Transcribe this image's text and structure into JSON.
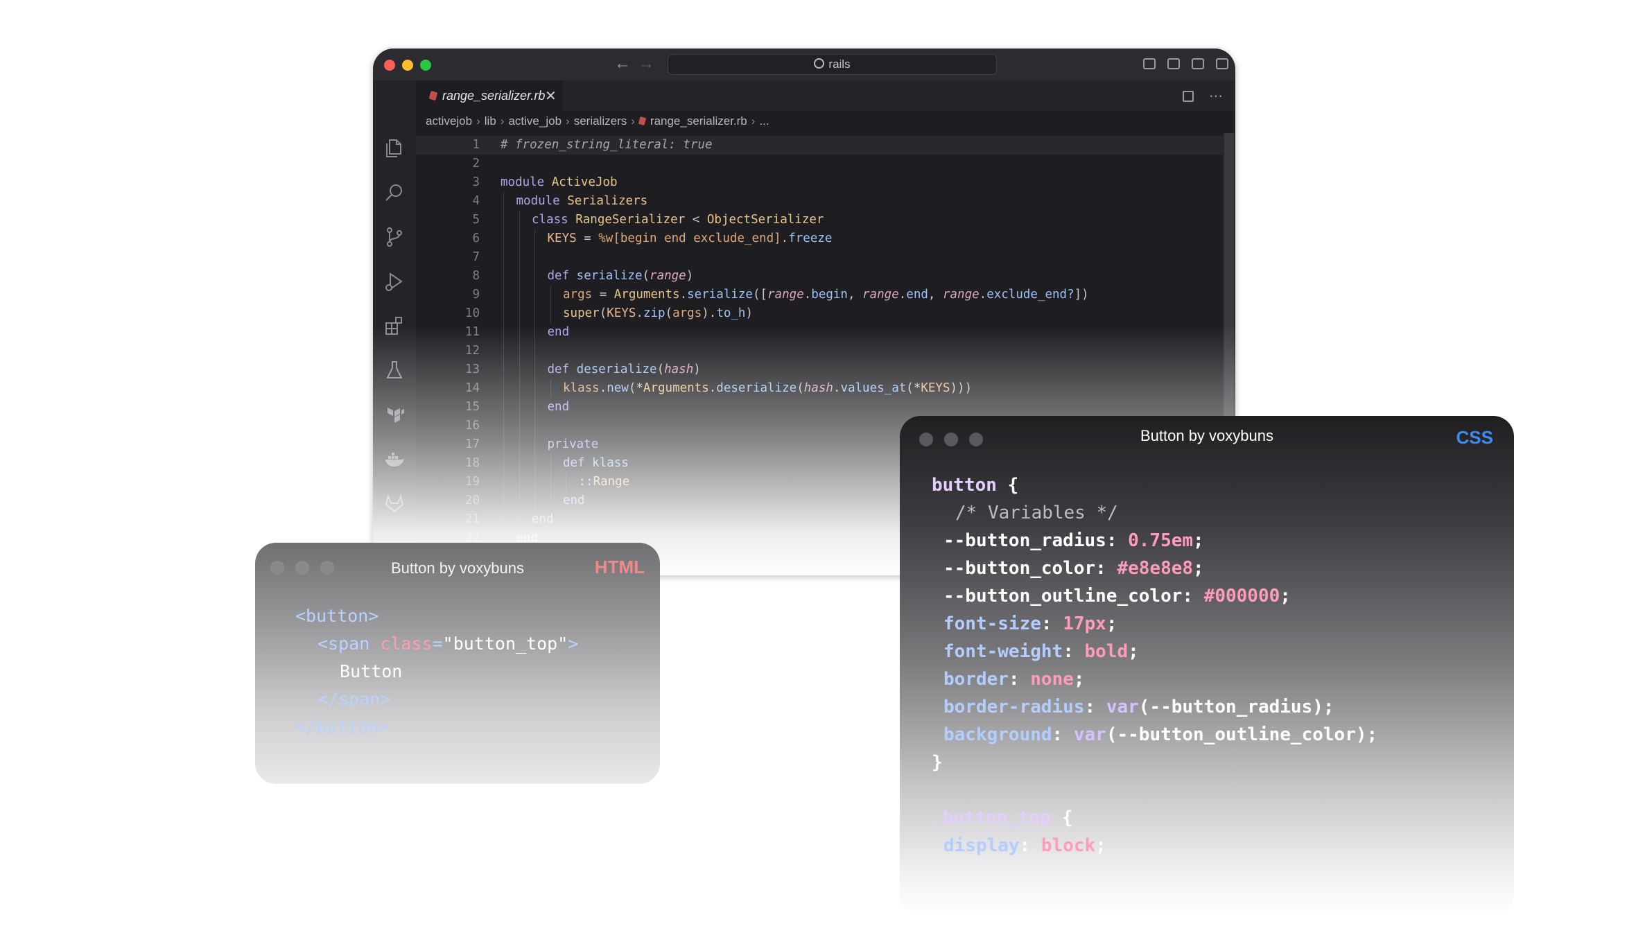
{
  "editor": {
    "search_text": "rails",
    "tab_name": "range_serializer.rb",
    "tab_close": "✕",
    "breadcrumbs": [
      "activejob",
      "lib",
      "active_job",
      "serializers",
      "range_serializer.rb",
      "..."
    ],
    "code_lines": [
      {
        "n": "1",
        "indent": 0,
        "tokens": [
          [
            "cm",
            "# frozen_string_literal: true"
          ]
        ]
      },
      {
        "n": "2",
        "indent": 0,
        "tokens": []
      },
      {
        "n": "3",
        "indent": 0,
        "tokens": [
          [
            "kw",
            "module "
          ],
          [
            "cls",
            "ActiveJob"
          ]
        ]
      },
      {
        "n": "4",
        "indent": 1,
        "tokens": [
          [
            "kw",
            "module "
          ],
          [
            "cls",
            "Serializers"
          ]
        ]
      },
      {
        "n": "5",
        "indent": 2,
        "tokens": [
          [
            "kw",
            "class "
          ],
          [
            "cls",
            "RangeSerializer"
          ],
          [
            "op",
            " < "
          ],
          [
            "cls",
            "ObjectSerializer"
          ]
        ]
      },
      {
        "n": "6",
        "indent": 3,
        "tokens": [
          [
            "const",
            "KEYS"
          ],
          [
            "op",
            " = "
          ],
          [
            "sym",
            "%w[begin end exclude_end]"
          ],
          [
            "op",
            "."
          ],
          [
            "fn",
            "freeze"
          ]
        ]
      },
      {
        "n": "7",
        "indent": 3,
        "tokens": []
      },
      {
        "n": "8",
        "indent": 3,
        "tokens": [
          [
            "kw",
            "def "
          ],
          [
            "fn",
            "serialize"
          ],
          [
            "op",
            "("
          ],
          [
            "it",
            "range"
          ],
          [
            "op",
            ")"
          ]
        ]
      },
      {
        "n": "9",
        "indent": 4,
        "tokens": [
          [
            "sym",
            "args"
          ],
          [
            "op",
            " = "
          ],
          [
            "cls",
            "Arguments"
          ],
          [
            "op",
            "."
          ],
          [
            "fn",
            "serialize"
          ],
          [
            "op",
            "(["
          ],
          [
            "it",
            "range"
          ],
          [
            "op",
            "."
          ],
          [
            "fn",
            "begin"
          ],
          [
            "op",
            ", "
          ],
          [
            "it",
            "range"
          ],
          [
            "op",
            "."
          ],
          [
            "fn",
            "end"
          ],
          [
            "op",
            ", "
          ],
          [
            "it",
            "range"
          ],
          [
            "op",
            "."
          ],
          [
            "fn",
            "exclude_end?"
          ],
          [
            "op",
            "])"
          ]
        ]
      },
      {
        "n": "10",
        "indent": 4,
        "tokens": [
          [
            "cls",
            "super"
          ],
          [
            "op",
            "("
          ],
          [
            "const",
            "KEYS"
          ],
          [
            "op",
            "."
          ],
          [
            "fn",
            "zip"
          ],
          [
            "op",
            "("
          ],
          [
            "sym",
            "args"
          ],
          [
            "op",
            ")."
          ],
          [
            "fn",
            "to_h"
          ],
          [
            "op",
            ")"
          ]
        ]
      },
      {
        "n": "11",
        "indent": 3,
        "tokens": [
          [
            "kw",
            "end"
          ]
        ]
      },
      {
        "n": "12",
        "indent": 3,
        "tokens": []
      },
      {
        "n": "13",
        "indent": 3,
        "tokens": [
          [
            "kw",
            "def "
          ],
          [
            "fn",
            "deserialize"
          ],
          [
            "op",
            "("
          ],
          [
            "it",
            "hash"
          ],
          [
            "op",
            ")"
          ]
        ]
      },
      {
        "n": "14",
        "indent": 4,
        "tokens": [
          [
            "sym",
            "klass"
          ],
          [
            "op",
            "."
          ],
          [
            "fn",
            "new"
          ],
          [
            "op",
            "(*"
          ],
          [
            "cls",
            "Arguments"
          ],
          [
            "op",
            "."
          ],
          [
            "fn",
            "deserialize"
          ],
          [
            "op",
            "("
          ],
          [
            "it",
            "hash"
          ],
          [
            "op",
            "."
          ],
          [
            "fn",
            "values_at"
          ],
          [
            "op",
            "(*"
          ],
          [
            "const",
            "KEYS"
          ],
          [
            "op",
            ")))"
          ]
        ]
      },
      {
        "n": "15",
        "indent": 3,
        "tokens": [
          [
            "kw",
            "end"
          ]
        ]
      },
      {
        "n": "16",
        "indent": 3,
        "tokens": []
      },
      {
        "n": "17",
        "indent": 3,
        "tokens": [
          [
            "kw",
            "private"
          ]
        ]
      },
      {
        "n": "18",
        "indent": 4,
        "tokens": [
          [
            "kw",
            "def "
          ],
          [
            "fn",
            "klass"
          ]
        ]
      },
      {
        "n": "19",
        "indent": 5,
        "tokens": [
          [
            "op",
            "::"
          ],
          [
            "cls",
            "Range"
          ]
        ]
      },
      {
        "n": "20",
        "indent": 4,
        "tokens": [
          [
            "kw",
            "end"
          ]
        ]
      },
      {
        "n": "21",
        "indent": 2,
        "tokens": [
          [
            "kw",
            "end"
          ]
        ]
      },
      {
        "n": "22",
        "indent": 1,
        "tokens": [
          [
            "kw",
            "end"
          ]
        ]
      }
    ]
  },
  "html_window": {
    "title": "Button by voxybuns",
    "lang": "HTML",
    "lines": [
      {
        "indent": 0,
        "tokens": [
          [
            "tag",
            "<button>"
          ]
        ]
      },
      {
        "indent": 1,
        "tokens": [
          [
            "tag",
            "<span "
          ],
          [
            "attr",
            "class"
          ],
          [
            "tag",
            "="
          ],
          [
            "str",
            "\"button_top\""
          ],
          [
            "tag",
            ">"
          ]
        ]
      },
      {
        "indent": 2,
        "tokens": [
          [
            "htxt",
            "Button"
          ]
        ]
      },
      {
        "indent": 1,
        "tokens": [
          [
            "tag",
            "</span>"
          ]
        ]
      },
      {
        "indent": 0,
        "tokens": [
          [
            "tag",
            "</button>"
          ]
        ]
      }
    ]
  },
  "css_window": {
    "title": "Button by voxybuns",
    "lang": "CSS",
    "lines": [
      {
        "indent": 0,
        "tokens": [
          [
            "sel",
            "button "
          ],
          [
            "brace",
            "{"
          ]
        ]
      },
      {
        "indent": 1,
        "tokens": [
          [
            "ccm",
            "/* Variables */"
          ]
        ]
      },
      {
        "indent": 0.5,
        "tokens": [
          [
            "var",
            "--button_radius"
          ],
          [
            "punc",
            ": "
          ],
          [
            "val",
            "0.75em"
          ],
          [
            "punc",
            ";"
          ]
        ]
      },
      {
        "indent": 0.5,
        "tokens": [
          [
            "var",
            "--button_color"
          ],
          [
            "punc",
            ": "
          ],
          [
            "val",
            "#e8e8e8"
          ],
          [
            "punc",
            ";"
          ]
        ]
      },
      {
        "indent": 0.5,
        "tokens": [
          [
            "var",
            "--button_outline_color"
          ],
          [
            "punc",
            ": "
          ],
          [
            "val",
            "#000000"
          ],
          [
            "punc",
            ";"
          ]
        ]
      },
      {
        "indent": 0.5,
        "tokens": [
          [
            "prop",
            "font-size"
          ],
          [
            "punc",
            ": "
          ],
          [
            "val",
            "17px"
          ],
          [
            "punc",
            ";"
          ]
        ]
      },
      {
        "indent": 0.5,
        "tokens": [
          [
            "prop",
            "font-weight"
          ],
          [
            "punc",
            ": "
          ],
          [
            "val",
            "bold"
          ],
          [
            "punc",
            ";"
          ]
        ]
      },
      {
        "indent": 0.5,
        "tokens": [
          [
            "prop",
            "border"
          ],
          [
            "punc",
            ": "
          ],
          [
            "val",
            "none"
          ],
          [
            "punc",
            ";"
          ]
        ]
      },
      {
        "indent": 0.5,
        "tokens": [
          [
            "prop",
            "border-radius"
          ],
          [
            "punc",
            ": "
          ],
          [
            "fnc",
            "var"
          ],
          [
            "punc",
            "(--button_radius);"
          ]
        ]
      },
      {
        "indent": 0.5,
        "tokens": [
          [
            "prop",
            "background"
          ],
          [
            "punc",
            ": "
          ],
          [
            "fnc",
            "var"
          ],
          [
            "punc",
            "(--button_outline_color);"
          ]
        ]
      },
      {
        "indent": 0,
        "tokens": [
          [
            "brace",
            "}"
          ]
        ]
      },
      {
        "indent": 0,
        "tokens": []
      },
      {
        "indent": 0,
        "tokens": [
          [
            "sel",
            ".button_top "
          ],
          [
            "brace",
            "{"
          ]
        ]
      },
      {
        "indent": 0.5,
        "tokens": [
          [
            "prop",
            "display"
          ],
          [
            "punc",
            ": "
          ],
          [
            "val",
            "block"
          ],
          [
            "punc",
            ";"
          ]
        ]
      }
    ]
  },
  "colors": {
    "traffic_red": "#ff5f57",
    "traffic_yellow": "#febc2e",
    "traffic_green": "#28c840",
    "html_accent": "#f08a8a",
    "css_accent": "#3f8cf0"
  },
  "icons": {
    "activity_bar": [
      "files-icon",
      "search-icon",
      "source-control-icon",
      "run-debug-icon",
      "extensions-icon",
      "testing-flask-icon",
      "terraform-icon",
      "docker-icon",
      "gitlab-icon",
      "more-icon"
    ],
    "titlebar": [
      "back-arrow-icon",
      "forward-arrow-icon",
      "toggle-sidebar-icon",
      "toggle-panel-icon",
      "toggle-secondary-sidebar-icon",
      "customize-layout-icon"
    ]
  }
}
